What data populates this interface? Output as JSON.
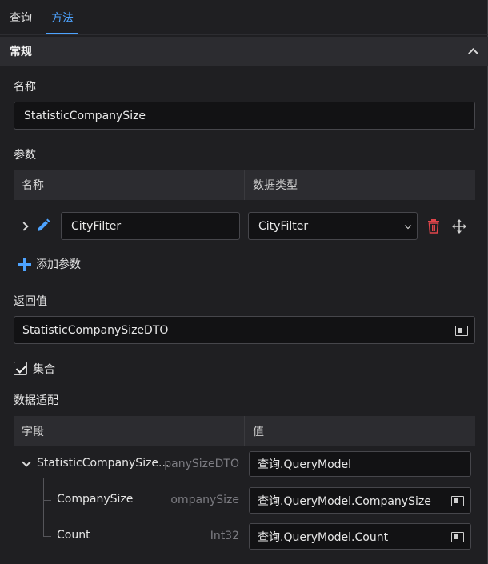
{
  "tabs": [
    {
      "label": "查询"
    },
    {
      "label": "方法"
    }
  ],
  "section": {
    "title": "常规"
  },
  "name_field": {
    "label": "名称",
    "value": "StatisticCompanySize"
  },
  "params": {
    "label": "参数",
    "columns": [
      "名称",
      "数据类型"
    ],
    "rows": [
      {
        "name": "CityFilter",
        "type": "CityFilter"
      }
    ],
    "add_label": "添加参数"
  },
  "return_value": {
    "label": "返回值",
    "value": "StatisticCompanySizeDTO"
  },
  "collection": {
    "label": "集合",
    "checked": true
  },
  "data_mapping": {
    "label": "数据适配",
    "columns": [
      "字段",
      "值"
    ],
    "rows": [
      {
        "field": "StatisticCompanySize...",
        "type": "panySizeDTO",
        "value": "查询.QueryModel"
      },
      {
        "field": "CompanySize",
        "type": "ompanySize",
        "value": "查询.QueryModel.CompanySize"
      },
      {
        "field": "Count",
        "type": "Int32",
        "value": "查询.QueryModel.Count"
      }
    ]
  },
  "colors": {
    "accent": "#4da3ff",
    "danger": "#e0454b",
    "background": "#1f1f22",
    "input_bg": "#121214",
    "header_bg": "#2c2c30"
  },
  "icons": [
    "chevron-up-icon",
    "chevron-right-icon",
    "pencil-icon",
    "trash-icon",
    "move-icon",
    "plus-icon",
    "picker-icon",
    "checkbox-check-icon",
    "chevron-down-icon"
  ]
}
